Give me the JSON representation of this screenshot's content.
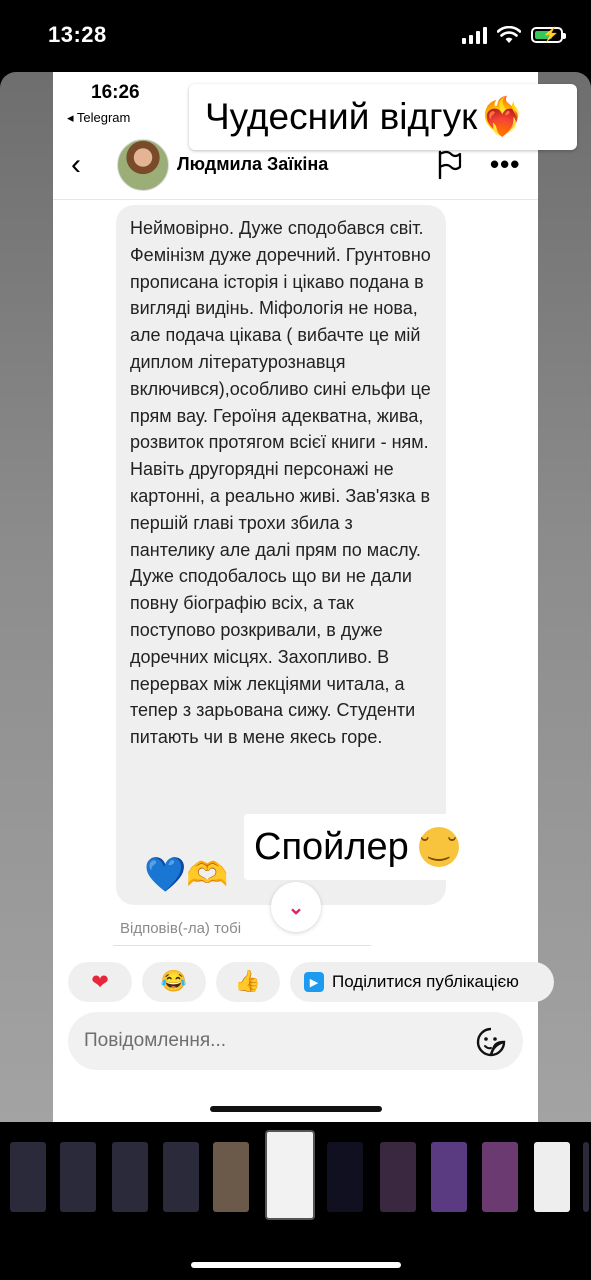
{
  "status_bar": {
    "time": "13:28"
  },
  "inner_status": {
    "time": "16:26",
    "back_app": "◂ Telegram"
  },
  "header": {
    "back_glyph": "‹",
    "contact_name": "Людмила Заїкіна",
    "more_glyph": "•••"
  },
  "message": {
    "text": "Неймовірно.  Дуже сподобався світ. Фемінізм дуже доречний. Грунтовно прописана історія і цікаво подана в вигляді видінь. Міфологія не нова, але подача цікава ( вибачте це мій диплом літературознавця включився),особливо сині ельфи це прям вау. Героїня адекватна,  жива, розвиток протягом всієї книги  - ням. Навіть другорядні персонажі не картонні, а реально живі. Зав'язка в першій главі трохи збила з пантелику але далі прям по маслу. Дуже сподобалось що ви не дали повну біографію всіх, а так поступово розкривали, в дуже доречних місцях. Захопливо. В перервах між лекціями читала, а тепер з зарьована сижу. Студенти питають чи в мене якесь горе.",
    "emojis": [
      "💙",
      "🫶"
    ],
    "replied_label": "Відповів(-ла) тобі"
  },
  "reactions": [
    {
      "name": "heart",
      "glyph": "❤"
    },
    {
      "name": "laugh",
      "glyph": "😂"
    },
    {
      "name": "thumbs-up",
      "glyph": "👍"
    }
  ],
  "share": {
    "label": "Поділитися публікацією"
  },
  "input": {
    "placeholder": "Повідомлення..."
  },
  "stickers": {
    "title": "Чудесний відгук",
    "title_emoji": "❤‍🔥",
    "spoiler": "Спойлер",
    "spoiler_emoji": "😏"
  },
  "filmstrip": {
    "thumbnails": [
      {
        "color": "#2a2a3a"
      },
      {
        "color": "#2a2a3a"
      },
      {
        "color": "#2a2a3a"
      },
      {
        "color": "#2a2a3a"
      },
      {
        "color": "#6b5a4a"
      },
      {
        "color": "#f2f2f2",
        "selected": true
      },
      {
        "color": "#101020"
      },
      {
        "color": "#3a2840"
      },
      {
        "color": "#5a3a80"
      },
      {
        "color": "#6a3a70"
      },
      {
        "color": "#eeeeee"
      },
      {
        "color": "#2a2a3a"
      }
    ]
  },
  "colors": {
    "accent_red": "#e8253b",
    "link_blue": "#1d9bf0",
    "bubble": "#efefef"
  }
}
